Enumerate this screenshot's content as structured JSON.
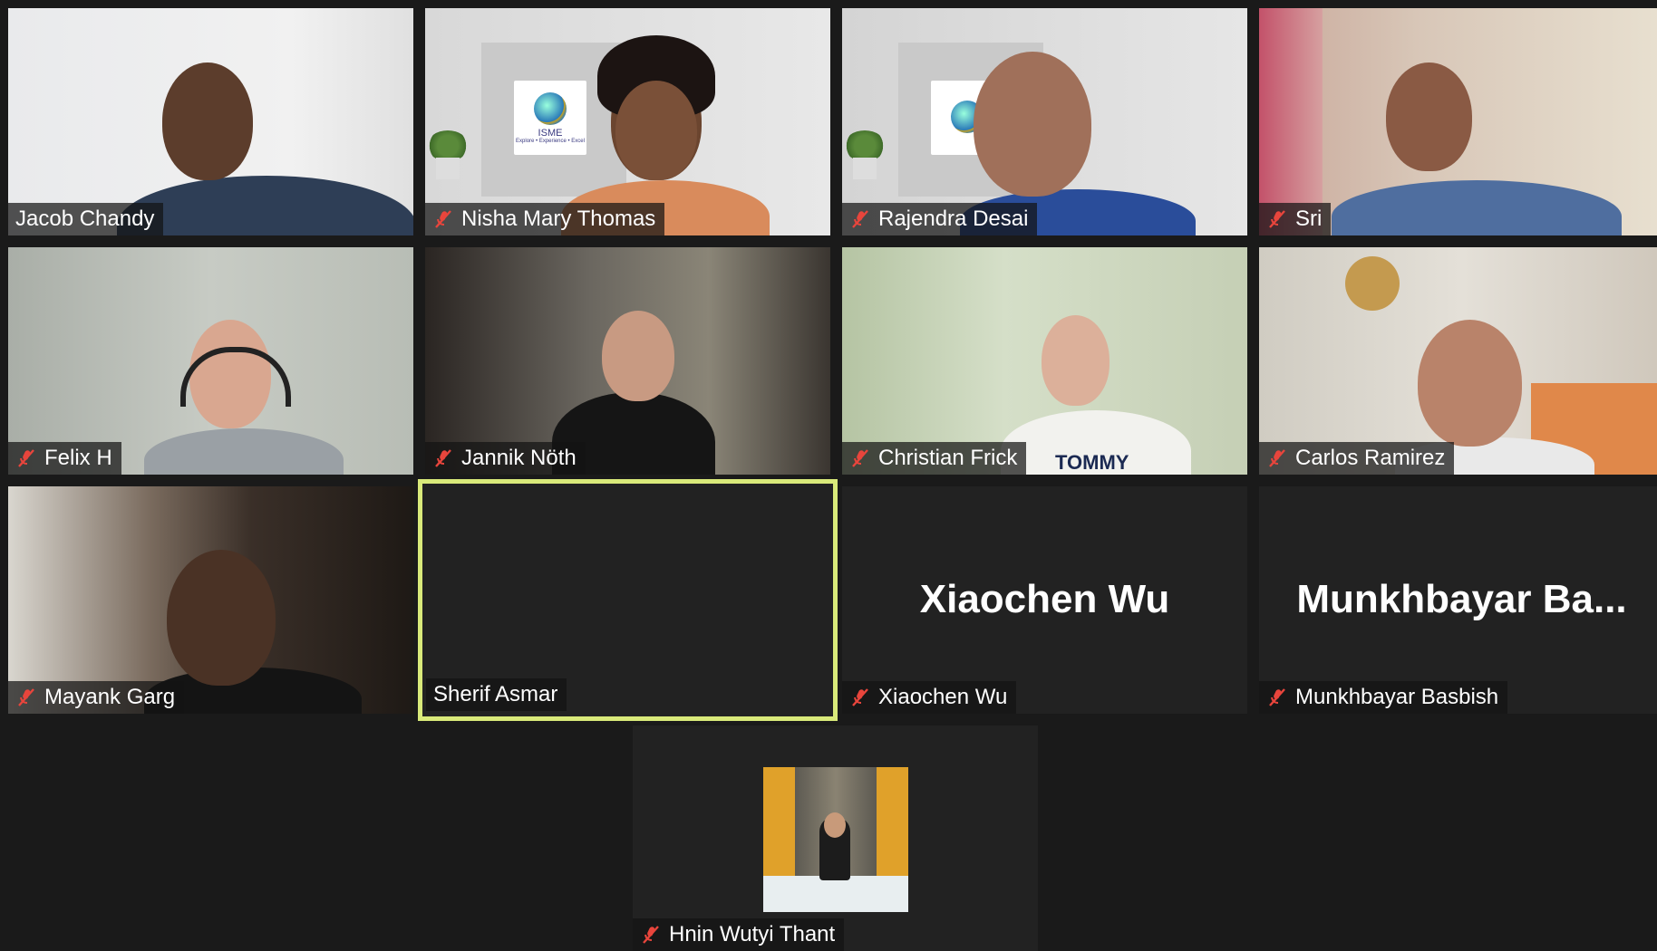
{
  "participants": [
    {
      "name": "Jacob Chandy",
      "muted": false
    },
    {
      "name": "Nisha Mary Thomas",
      "muted": true
    },
    {
      "name": "Rajendra Desai",
      "muted": true
    },
    {
      "name": "Sri",
      "muted": true
    },
    {
      "name": "Felix H",
      "muted": true
    },
    {
      "name": "Jannik Nöth",
      "muted": true
    },
    {
      "name": "Christian Frick",
      "muted": true
    },
    {
      "name": "Carlos Ramirez",
      "muted": true
    },
    {
      "name": "Mayank Garg",
      "muted": true
    },
    {
      "name": "Sherif Asmar",
      "muted": false,
      "speaking": true
    },
    {
      "name": "Xiaochen Wu",
      "muted": true,
      "video_off_label": "Xiaochen Wu"
    },
    {
      "name": "Munkhbayar Basbish",
      "muted": true,
      "video_off_label": "Munkhbayar  Ba..."
    },
    {
      "name": "Hnin Wutyi Thant",
      "muted": true
    }
  ],
  "logo_text": "ISME",
  "logo_tagline": "Explore • Experience • Excel",
  "shirt_text": "TOMMY",
  "colors": {
    "background": "#1a1a1a",
    "tile": "#222222",
    "active_border": "#d9ea7a",
    "muted_icon": "#e8453c"
  }
}
